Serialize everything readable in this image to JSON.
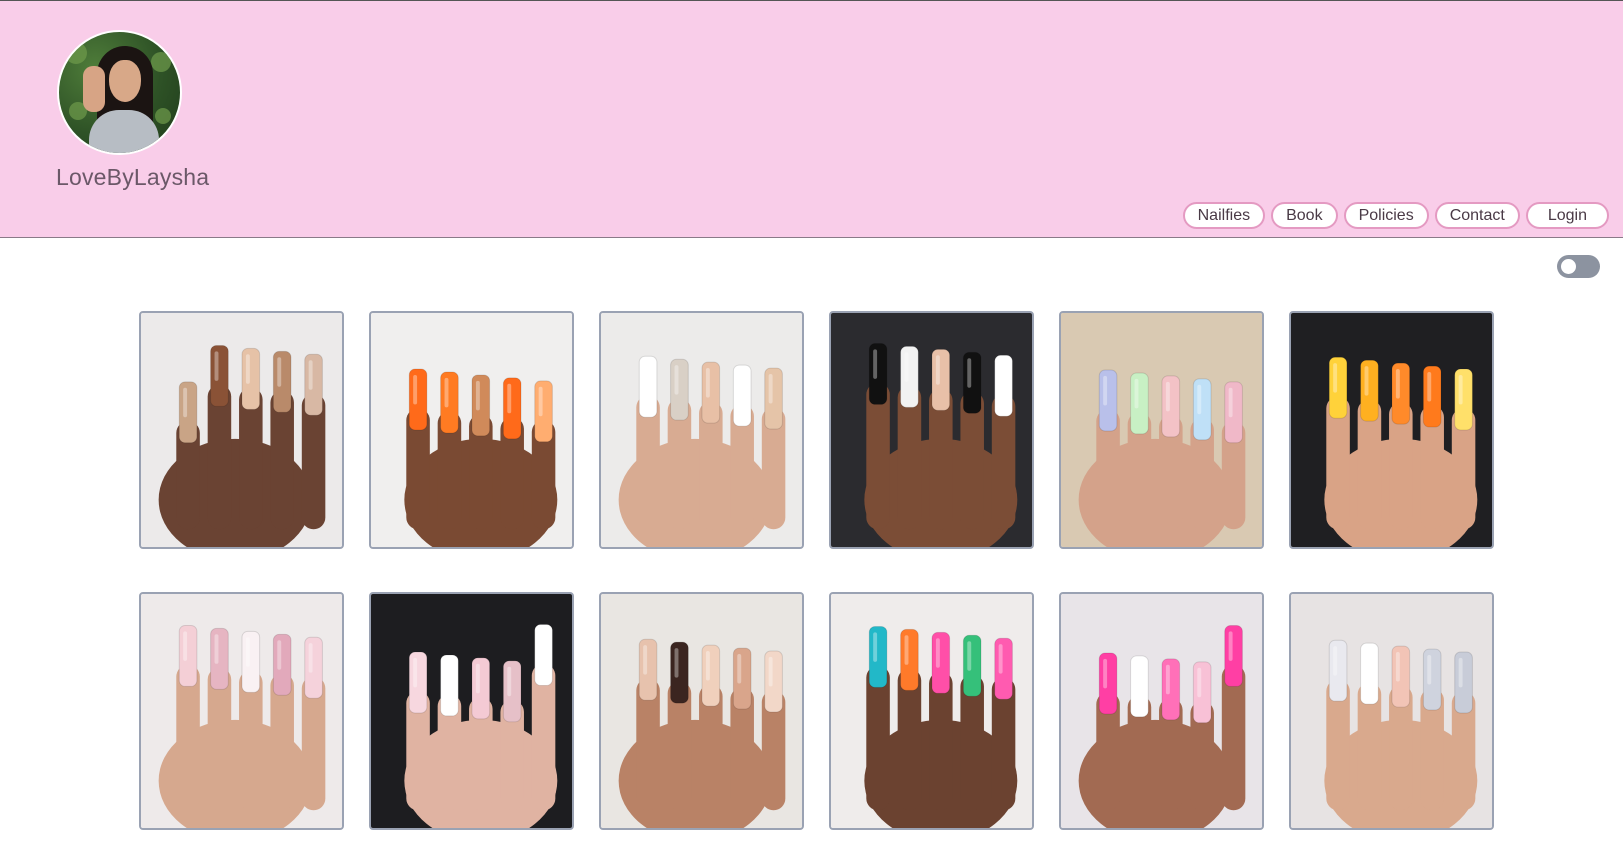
{
  "header": {
    "brand_name": "LoveByLaysha",
    "background": "#f9cde9"
  },
  "nav": {
    "items": [
      "Nailfies",
      "Book",
      "Policies",
      "Contact",
      "Login"
    ]
  },
  "theme_toggle": {
    "state": "off"
  },
  "gallery": {
    "photos": [
      {
        "bg": "#eceaea",
        "skin": "#6a4333",
        "nails": [
          "#c9a486",
          "#8a5236",
          "#e6c2a7",
          "#b98a6a",
          "#d8b8a4"
        ]
      },
      {
        "bg": "#f0efee",
        "skin": "#7a4a33",
        "nails": [
          "#ff6a1a",
          "#ff7b22",
          "#d08a5a",
          "#ff6a1a",
          "#ffad70"
        ]
      },
      {
        "bg": "#ecebea",
        "skin": "#d8ab92",
        "nails": [
          "#ffffff",
          "#d9d0c6",
          "#e8c0a6",
          "#ffffff",
          "#e5c4a8"
        ]
      },
      {
        "bg": "#2b2b2f",
        "skin": "#7b4d36",
        "nails": [
          "#111111",
          "#f2f2f2",
          "#e8c0a8",
          "#111111",
          "#ffffff"
        ]
      },
      {
        "bg": "#d9c9b2",
        "skin": "#d4a28a",
        "nails": [
          "#b9c0ea",
          "#c8f0c4",
          "#f3c2c6",
          "#bfe0f7",
          "#f0b8c8"
        ]
      },
      {
        "bg": "#1f1f22",
        "skin": "#d9a386",
        "nails": [
          "#ffd23a",
          "#ffb020",
          "#ff8a2a",
          "#ff7a1c",
          "#ffe06a"
        ]
      },
      {
        "bg": "#eeeaea",
        "skin": "#d6a88e",
        "nails": [
          "#f4cfd6",
          "#e6b5c2",
          "#f9f1f3",
          "#e2a9bb",
          "#f5d2db"
        ]
      },
      {
        "bg": "#1d1d20",
        "skin": "#e0b3a2",
        "nails": [
          "#f7d7df",
          "#ffffff",
          "#f4cad4",
          "#e6c0c8",
          "#ffffff"
        ]
      },
      {
        "bg": "#e9e6e2",
        "skin": "#b98266",
        "nails": [
          "#e7c2ad",
          "#3b2520",
          "#f0d0bc",
          "#d9a58b",
          "#f2d7c8"
        ]
      },
      {
        "bg": "#efeceb",
        "skin": "#6b4230",
        "nails": [
          "#22b8c8",
          "#ff7a2a",
          "#ff4fa8",
          "#35c07a",
          "#ff5bb0"
        ]
      },
      {
        "bg": "#e8e4e8",
        "skin": "#a26a52",
        "nails": [
          "#ff3fa4",
          "#ffffff",
          "#ff70b8",
          "#f8c1d6",
          "#ff3fa4"
        ]
      },
      {
        "bg": "#e7e3e3",
        "skin": "#d9a98d",
        "nails": [
          "#e9e9ef",
          "#ffffff",
          "#f2c4b6",
          "#cfd3de",
          "#c8ccd8"
        ]
      }
    ]
  }
}
